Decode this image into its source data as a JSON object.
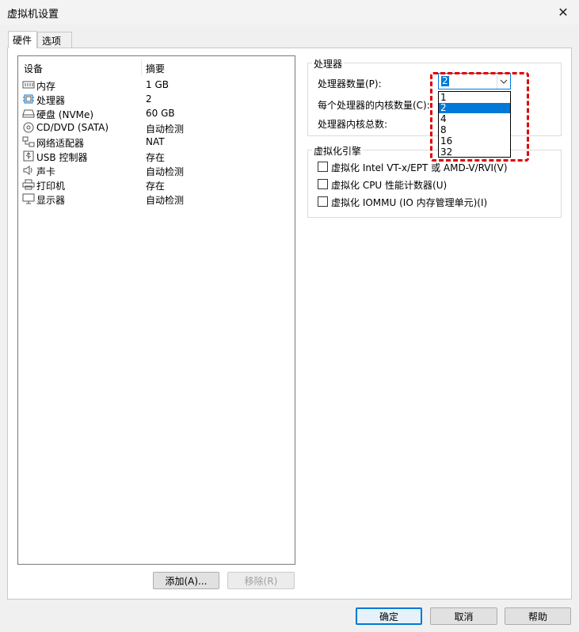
{
  "window": {
    "title": "虚拟机设置",
    "close_glyph": "✕"
  },
  "tabs": [
    {
      "label": "硬件",
      "active": true
    },
    {
      "label": "选项",
      "active": false
    }
  ],
  "device_list": {
    "headers": [
      "设备",
      "摘要"
    ],
    "rows": [
      {
        "icon": "memory-icon",
        "name": "内存",
        "summary": "1 GB"
      },
      {
        "icon": "processor-icon",
        "name": "处理器",
        "summary": "2",
        "selected": true
      },
      {
        "icon": "hard-disk-icon",
        "name": "硬盘 (NVMe)",
        "summary": "60 GB"
      },
      {
        "icon": "cd-dvd-icon",
        "name": "CD/DVD (SATA)",
        "summary": "自动检测"
      },
      {
        "icon": "network-adapter-icon",
        "name": "网络适配器",
        "summary": "NAT"
      },
      {
        "icon": "usb-icon",
        "name": "USB 控制器",
        "summary": "存在"
      },
      {
        "icon": "sound-icon",
        "name": "声卡",
        "summary": "自动检测"
      },
      {
        "icon": "printer-icon",
        "name": "打印机",
        "summary": "存在"
      },
      {
        "icon": "display-icon",
        "name": "显示器",
        "summary": "自动检测"
      }
    ]
  },
  "device_buttons": {
    "add_label": "添加(A)...",
    "remove_label": "移除(R)"
  },
  "processor_group": {
    "title": "处理器",
    "count_label": "处理器数量(P):",
    "cores_label": "每个处理器的内核数量(C):",
    "total_label": "处理器内核总数:",
    "count_value": "2",
    "options": [
      "1",
      "2",
      "4",
      "8",
      "16",
      "32"
    ],
    "selected_option": "2"
  },
  "virtualization_group": {
    "title": "虚拟化引擎",
    "options": [
      {
        "label": "虚拟化 Intel VT-x/EPT 或 AMD-V/RVI(V)",
        "checked": false
      },
      {
        "label": "虚拟化 CPU 性能计数器(U)",
        "checked": false
      },
      {
        "label": "虚拟化 IOMMU (IO 内存管理单元)(I)",
        "checked": false
      }
    ]
  },
  "footer": {
    "ok_label": "确定",
    "cancel_label": "取消",
    "help_label": "帮助"
  },
  "colors": {
    "accent": "#0078d7",
    "highlight": "#e00000"
  }
}
